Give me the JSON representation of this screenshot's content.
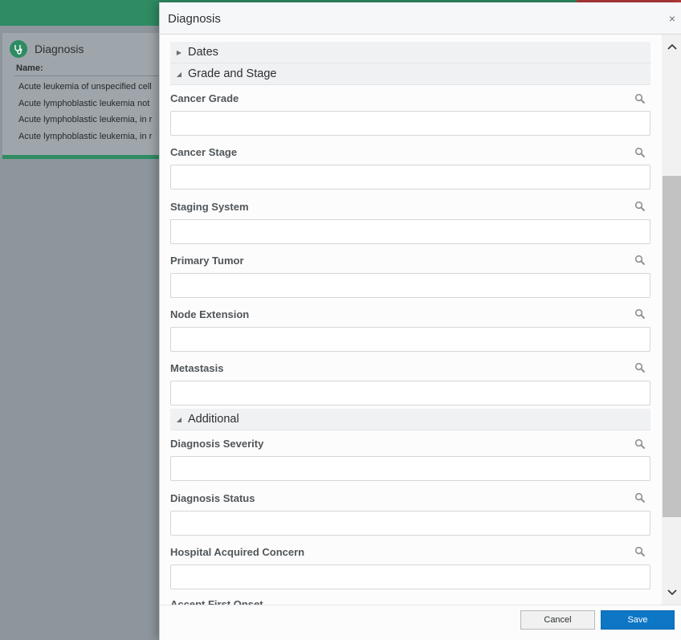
{
  "background": {
    "card": {
      "title": "Diagnosis",
      "name_label": "Name:",
      "rows": [
        "Acute leukemia of unspecified cell",
        "Acute lymphoblastic leukemia not",
        "Acute lymphoblastic leukemia, in r",
        "Acute lymphoblastic leukemia, in r"
      ]
    }
  },
  "dialog": {
    "title": "Diagnosis",
    "close": "×",
    "sections": {
      "dates": "Dates",
      "grade_stage": "Grade and Stage",
      "additional": "Additional"
    },
    "fields": {
      "cancer_grade": "Cancer Grade",
      "cancer_stage": "Cancer Stage",
      "staging_system": "Staging System",
      "primary_tumor": "Primary Tumor",
      "node_extension": "Node Extension",
      "metastasis": "Metastasis",
      "diagnosis_severity": "Diagnosis Severity",
      "diagnosis_status": "Diagnosis Status",
      "hospital_acquired_concern": "Hospital Acquired Concern",
      "partial_next": "Accept First Onset"
    },
    "buttons": {
      "cancel": "Cancel",
      "save": "Save"
    }
  },
  "icons": {
    "collapsed": "▶",
    "expanded": "◢",
    "scroll_up": "chevron-up-icon",
    "scroll_down": "chevron-down-icon",
    "search": "search-icon"
  },
  "colors": {
    "brand_green": "#2e8b62",
    "primary_blue": "#0d76c5"
  }
}
